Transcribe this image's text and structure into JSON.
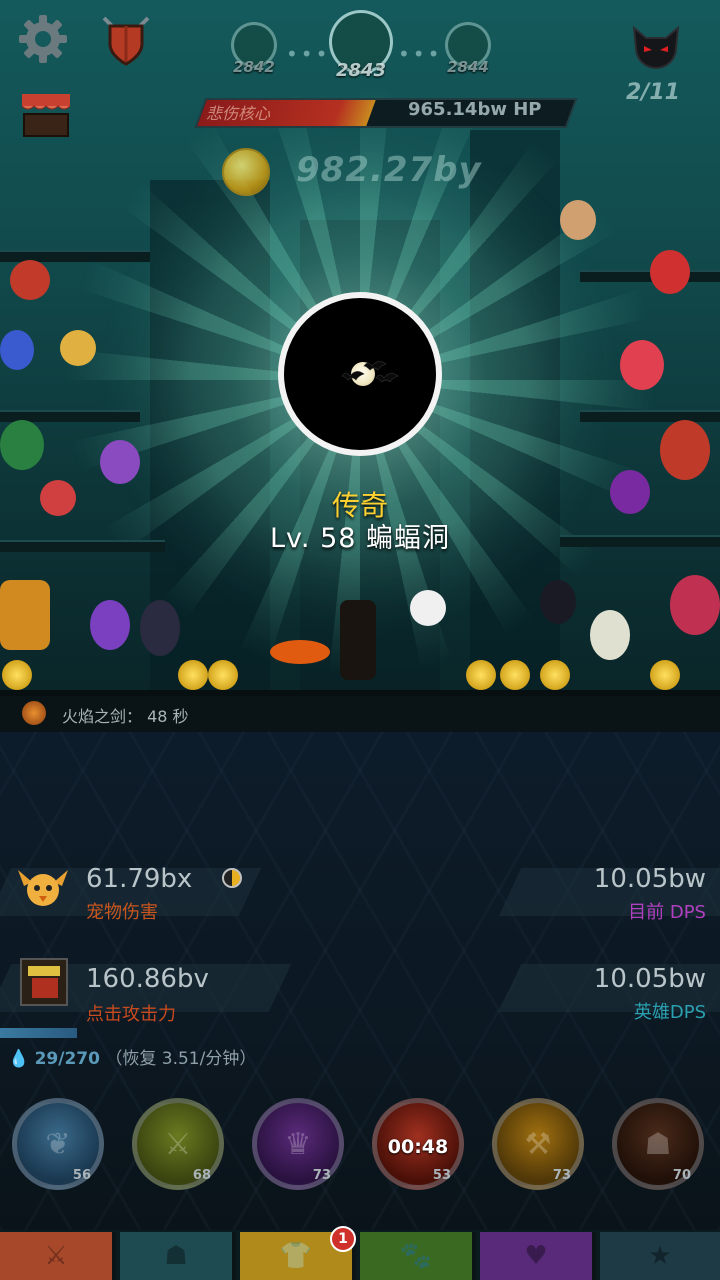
{
  "stages": {
    "prev": "2842",
    "current": "2843",
    "next": "2844"
  },
  "boss": {
    "progress": "2/11",
    "name": "悲伤核心",
    "hp": "965.14bw HP",
    "hp_fraction": 0.46
  },
  "gold": {
    "amount": "982.27by"
  },
  "reward": {
    "rarity": "传奇",
    "name": "Lv. 58 蝙蝠洞"
  },
  "active_skill": {
    "text": "火焰之剑：  48 秒"
  },
  "stats": {
    "pet_damage": {
      "value": "61.79bx",
      "label": "宠物伤害"
    },
    "current_dps": {
      "value": "10.05bw",
      "label": "目前 DPS"
    },
    "tap_damage": {
      "value": "160.86bv",
      "label": "点击攻击力"
    },
    "hero_dps": {
      "value": "10.05bw",
      "label": "英雄DPS"
    }
  },
  "mana": {
    "current": "29/270",
    "regen": "（恢复 3.51/分钟）",
    "fraction": 0.107
  },
  "skills": [
    {
      "name": "heavenly-strike",
      "level": "56",
      "cooldown": ""
    },
    {
      "name": "deadly-strike",
      "level": "68",
      "cooldown": ""
    },
    {
      "name": "hand-of-midas",
      "level": "73",
      "cooldown": ""
    },
    {
      "name": "fire-sword",
      "level": "53",
      "cooldown": "00:48"
    },
    {
      "name": "war-cry",
      "level": "73",
      "cooldown": ""
    },
    {
      "name": "shadow-clone",
      "level": "70",
      "cooldown": ""
    }
  ],
  "tabs": {
    "badge": "1"
  },
  "colors": {
    "rarity": "#ffd130",
    "pet_label": "#c8561e",
    "tap_label": "#c84a1e",
    "dps_label": "#b040c0",
    "hero_dps_label": "#2aa0b0"
  }
}
